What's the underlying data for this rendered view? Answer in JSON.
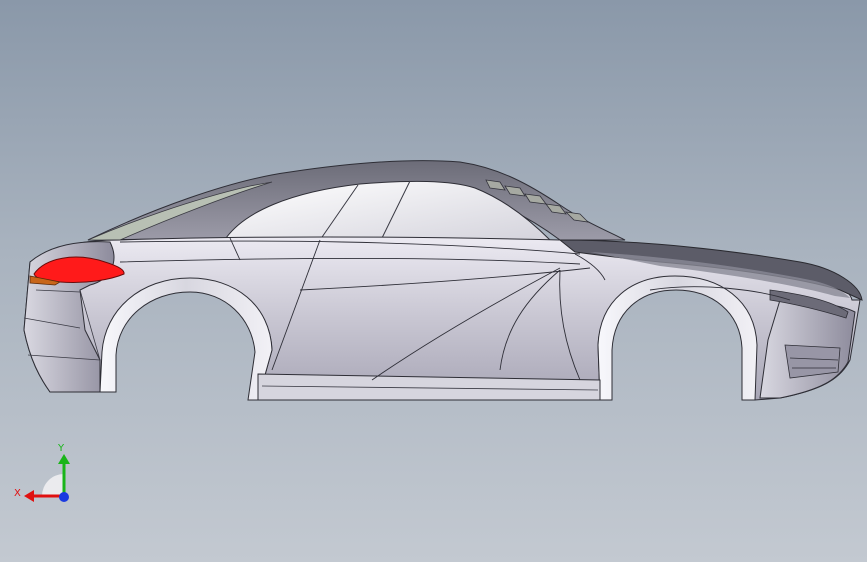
{
  "viewport": {
    "background_top": "#8a98a9",
    "background_bottom": "#c3c9d1"
  },
  "model": {
    "body_color": "#c9c8d4",
    "taillight_color": "#ff1a1a",
    "reflector_color": "#c8661a"
  },
  "triad": {
    "x_label": "X",
    "y_label": "Y",
    "x_color": "#e01010",
    "y_color": "#19b519",
    "z_color": "#1a3ae0"
  }
}
